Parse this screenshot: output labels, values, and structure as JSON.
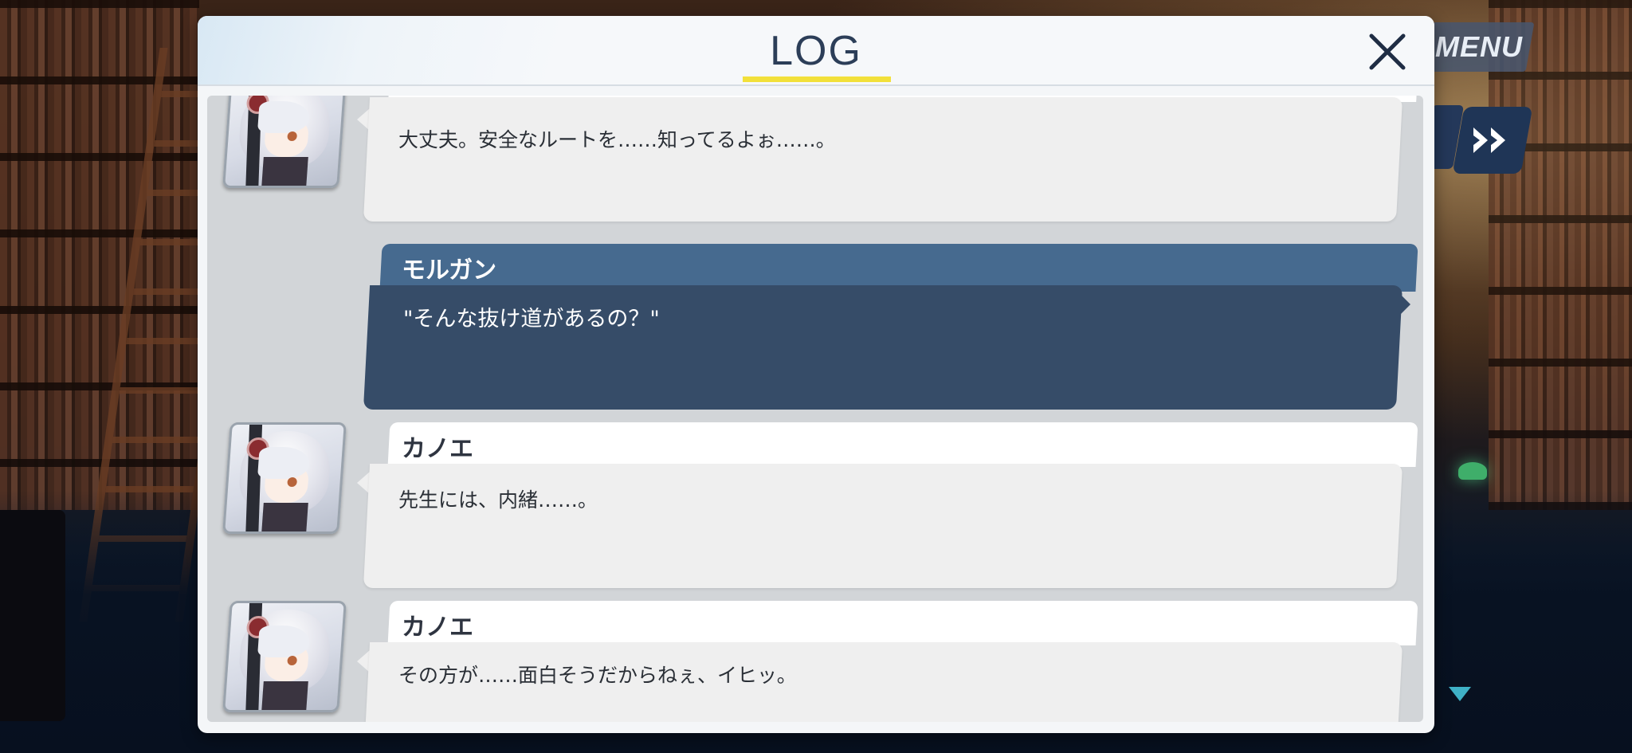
{
  "hud": {
    "menu_label": "MENU",
    "fast_forward_icon": "fast-forward-icon"
  },
  "log": {
    "title": "LOG",
    "close_icon": "close-icon",
    "entries": [
      {
        "speaker": "",
        "text": "大丈夫。安全なルートを……知ってるよぉ……。",
        "is_player": false,
        "portrait": "kanoe-portrait"
      },
      {
        "speaker": "モルガン",
        "text": "\"そんな抜け道があるの？\"",
        "is_player": true
      },
      {
        "speaker": "カノエ",
        "text": "先生には、内緒……。",
        "is_player": false,
        "portrait": "kanoe-portrait"
      },
      {
        "speaker": "カノエ",
        "text": "その方が……面白そうだからねぇ、イヒッ。",
        "is_player": false,
        "portrait": "kanoe-portrait"
      }
    ]
  },
  "colors": {
    "log_accent": "#f2e03a",
    "player_band": "#466a8f",
    "player_box": "#364c68",
    "title_text": "#2c3e58"
  }
}
